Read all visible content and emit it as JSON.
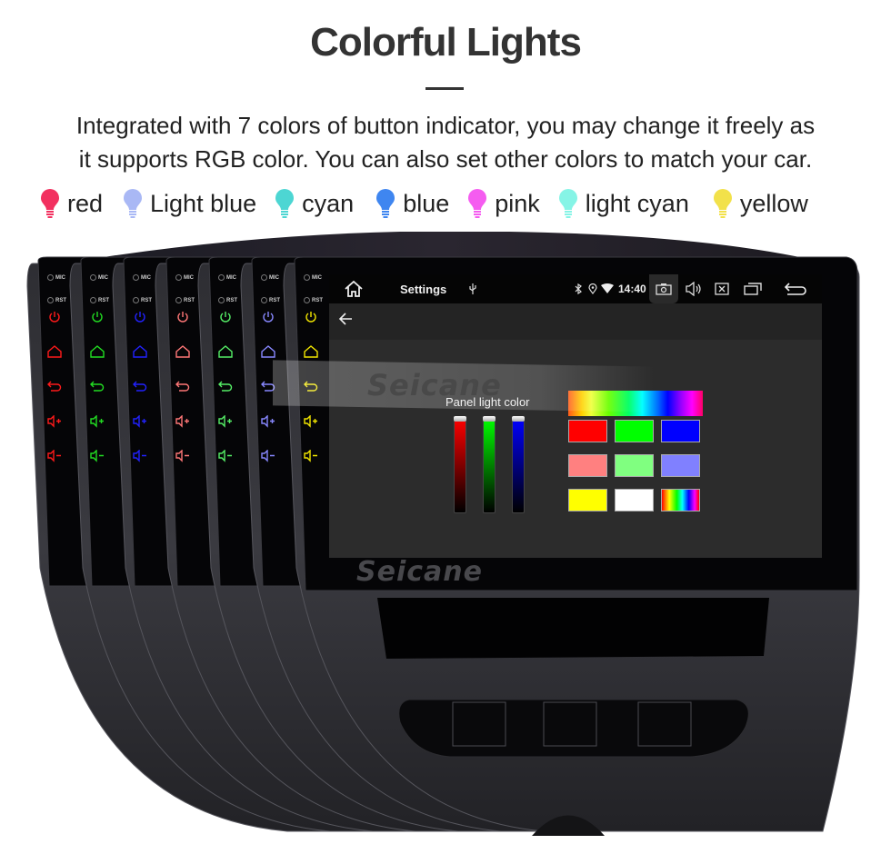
{
  "header": {
    "title": "Colorful Lights",
    "description_line1": "Integrated with 7 colors of button indicator, you may change it freely as",
    "description_line2": "it supports RGB color. You can also set other colors to match your car."
  },
  "legend": [
    {
      "label": "red",
      "color": "#f2305f"
    },
    {
      "label": "Light blue",
      "color": "#a9b8f5"
    },
    {
      "label": "cyan",
      "color": "#4dd6d3"
    },
    {
      "label": "blue",
      "color": "#3f86f0"
    },
    {
      "label": "pink",
      "color": "#f55cf0"
    },
    {
      "label": "light cyan",
      "color": "#86f4e6"
    },
    {
      "label": "yellow",
      "color": "#f2e14a"
    }
  ],
  "units": [
    {
      "button_color": "#ff1a1a"
    },
    {
      "button_color": "#22dd22"
    },
    {
      "button_color": "#2222ff"
    },
    {
      "button_color": "#ff7777"
    },
    {
      "button_color": "#55ee66"
    },
    {
      "button_color": "#8888ff"
    },
    {
      "button_color": "#f2e600"
    }
  ],
  "side_panel": {
    "mic_label": "MIC",
    "rst_label": "RST",
    "buttons": [
      "power-icon",
      "home-icon",
      "back-icon",
      "volume-up-icon",
      "volume-down-icon"
    ]
  },
  "status_bar": {
    "app_title": "Settings",
    "time": "14:40",
    "icons": [
      "home-icon",
      "usb-icon",
      "bluetooth-icon",
      "location-icon",
      "wifi-icon",
      "screenshot-icon",
      "volume-icon",
      "close-window-icon",
      "recent-apps-icon",
      "return-icon"
    ]
  },
  "settings_screen": {
    "panel_title": "Panel light color",
    "sliders": [
      {
        "channel": "red",
        "value": 1.0,
        "color": "#ff0000"
      },
      {
        "channel": "green",
        "value": 1.0,
        "color": "#00ff00"
      },
      {
        "channel": "blue",
        "value": 1.0,
        "color": "#0000ff"
      }
    ],
    "swatches": [
      [
        "#ff0000",
        "#00ff00",
        "#0000ff"
      ],
      [
        "#ff8080",
        "#80ff80",
        "#8080ff"
      ],
      [
        "#ffff00",
        "#ffffff",
        "rainbow"
      ]
    ]
  },
  "branding": {
    "watermark": "Seicane"
  }
}
